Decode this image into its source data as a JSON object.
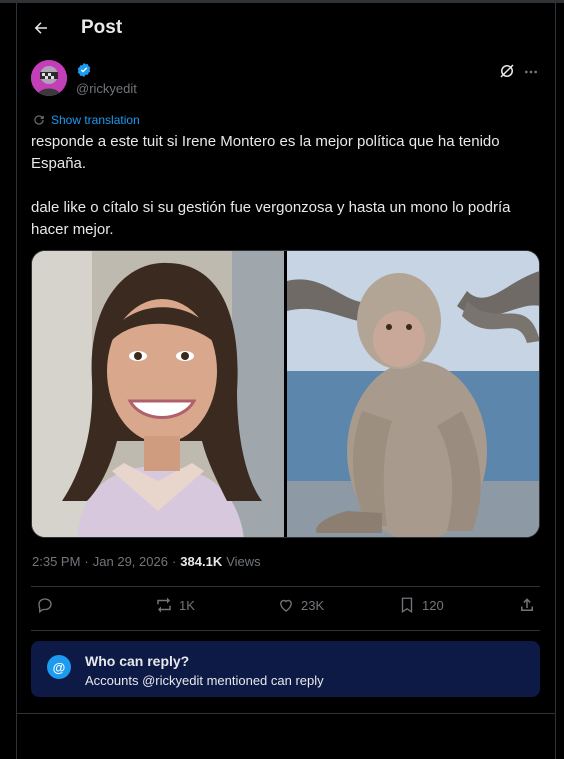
{
  "header": {
    "back_icon": "arrow-left-icon",
    "title": "Post"
  },
  "author": {
    "avatar_icon": "avatar",
    "verified_icon": "verified-badge-icon",
    "handle": "@rickyedit",
    "grok_icon": "grok-icon",
    "more_icon": "more-icon"
  },
  "translation": {
    "label": "Show translation"
  },
  "tweet": {
    "line1": "responde a este tuit si Irene Montero es la mejor política que ha tenido España.",
    "line2": "dale like o cítalo si su gestión fue vergonzosa y hasta un mono lo podría hacer mejor."
  },
  "media": {
    "image_count": 2
  },
  "meta": {
    "time": "2:35 PM",
    "separator": "·",
    "date": "Jan 29, 2026",
    "views_count": "384.1K",
    "views_label": "Views"
  },
  "actions": {
    "reply_count": "",
    "retweet_count": "1K",
    "like_count": "23K",
    "bookmark_count": "120"
  },
  "reply_settings": {
    "icon_glyph": "@",
    "title": "Who can reply?",
    "description": "Accounts @rickyedit mentioned can reply"
  },
  "colors": {
    "accent": "#1d9bf0",
    "background": "#000000",
    "text": "#e7e9ea",
    "muted": "#71767b",
    "reply_box": "#0d1a45"
  }
}
